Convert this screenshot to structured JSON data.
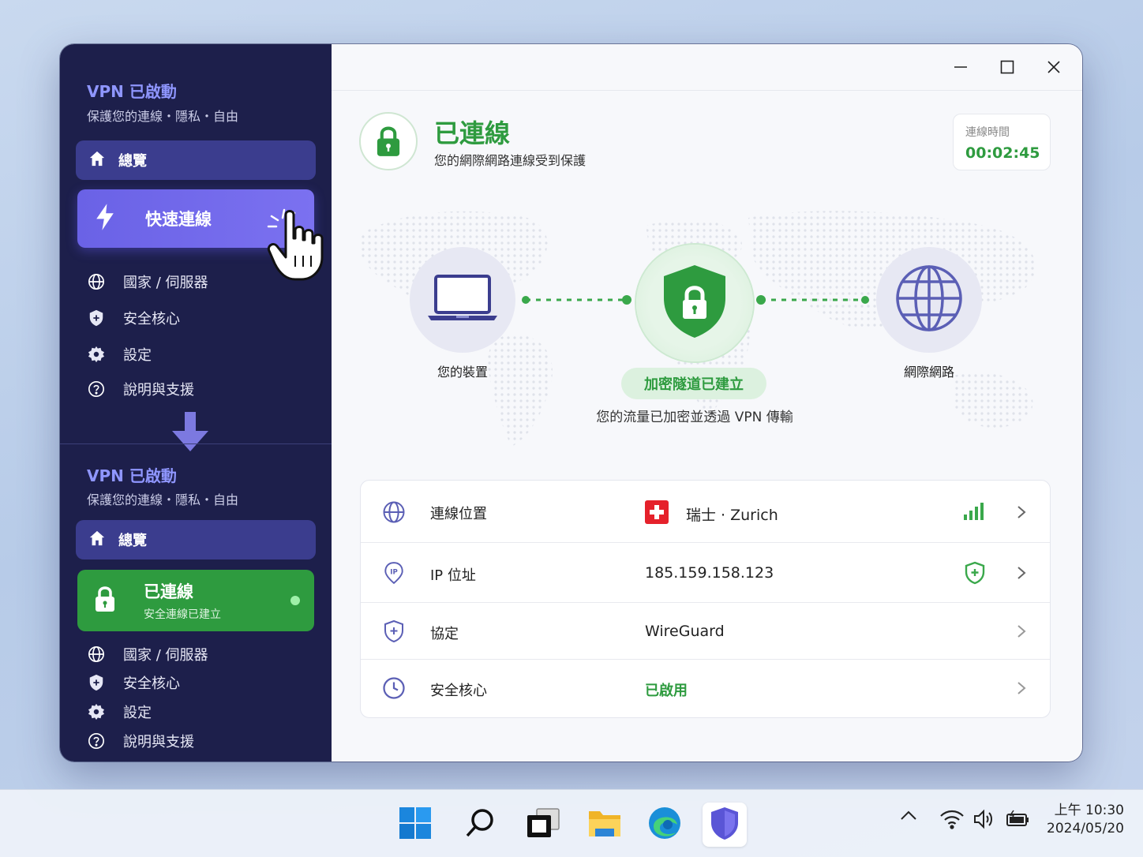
{
  "sidebar_top": {
    "title": "VPN 已啟動",
    "subtitle": "保護您的連線・隱私・自由",
    "overview_label": "總覽",
    "quick_connect_label": "快速連線",
    "items": [
      {
        "label": "國家 / 伺服器",
        "icon": "globe-icon"
      },
      {
        "label": "安全核心",
        "icon": "shield-icon"
      },
      {
        "label": "設定",
        "icon": "gear-icon"
      },
      {
        "label": "說明與支援",
        "icon": "help-icon"
      }
    ]
  },
  "sidebar_bottom": {
    "title": "VPN 已啟動",
    "subtitle": "保護您的連線・隱私・自由",
    "overview_label": "總覽",
    "connected_title": "已連線",
    "connected_subtitle": "安全連線已建立",
    "items": [
      {
        "label": "國家 / 伺服器",
        "icon": "globe-icon"
      },
      {
        "label": "安全核心",
        "icon": "shield-icon"
      },
      {
        "label": "設定",
        "icon": "gear-icon"
      },
      {
        "label": "說明與支援",
        "icon": "help-icon"
      }
    ]
  },
  "header": {
    "status_title": "已連線",
    "status_subtitle": "您的網際網路連線受到保護",
    "timer_label": "連線時間",
    "timer_value": "00:02:45"
  },
  "diagram": {
    "device_label": "您的裝置",
    "internet_label": "網際網路",
    "tunnel_badge": "加密隧道已建立",
    "tunnel_subtitle": "您的流量已加密並透過 VPN 傳輸"
  },
  "details": [
    {
      "label": "連線位置",
      "value": "瑞士 · Zurich",
      "icon": "globe-icon",
      "status_icon": "signal-bars-icon"
    },
    {
      "label": "IP 位址",
      "value": "185.159.158.123",
      "icon": "ip-pin-icon",
      "status_icon": "shield-check-icon"
    },
    {
      "label": "協定",
      "value": "WireGuard",
      "icon": "shield-outline-icon"
    },
    {
      "label": "安全核心",
      "value": "已啟用",
      "icon": "clock-icon"
    }
  ],
  "colors": {
    "accent_green": "#2e9b3f",
    "sidebar_bg": "#1d1f4b",
    "accent_purple": "#6a62e6"
  },
  "taskbar": {
    "time": "上午 10:30",
    "date": "2024/05/20"
  }
}
